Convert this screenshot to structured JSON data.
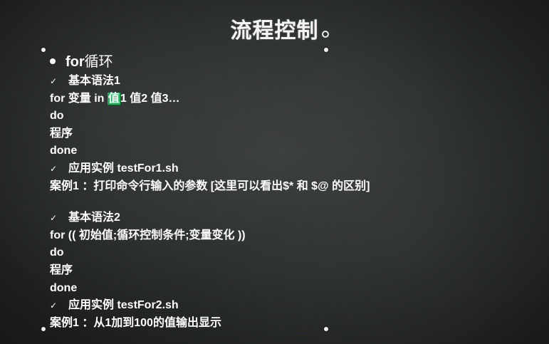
{
  "slide": {
    "title": "流程控制",
    "heading_bold": "for",
    "heading_rest": "循环",
    "check_glyph": "✓",
    "section1": {
      "label": "基本语法1",
      "syntax_pre": "for 变量 in ",
      "syntax_highlight": "值",
      "syntax_post": "1 值2 值3…",
      "do": "do",
      "body": "程序",
      "done": "done",
      "example_label": "应用实例 testFor1.sh",
      "example_case": "案例1 ：打印命令行输入的参数 [这里可以看出$* 和 $@ 的区别]"
    },
    "section2": {
      "label": "基本语法2",
      "syntax": "for (( 初始值;循环控制条件;变量变化 ))",
      "do": "do",
      "body": "程序",
      "done": "done",
      "example_label": "应用实例 testFor2.sh",
      "example_case": "案例1 ：从1加到100的值输出显示"
    }
  },
  "colors": {
    "highlight": "#19b35a",
    "text": "#ffffff",
    "board": "#2c2f2f"
  }
}
